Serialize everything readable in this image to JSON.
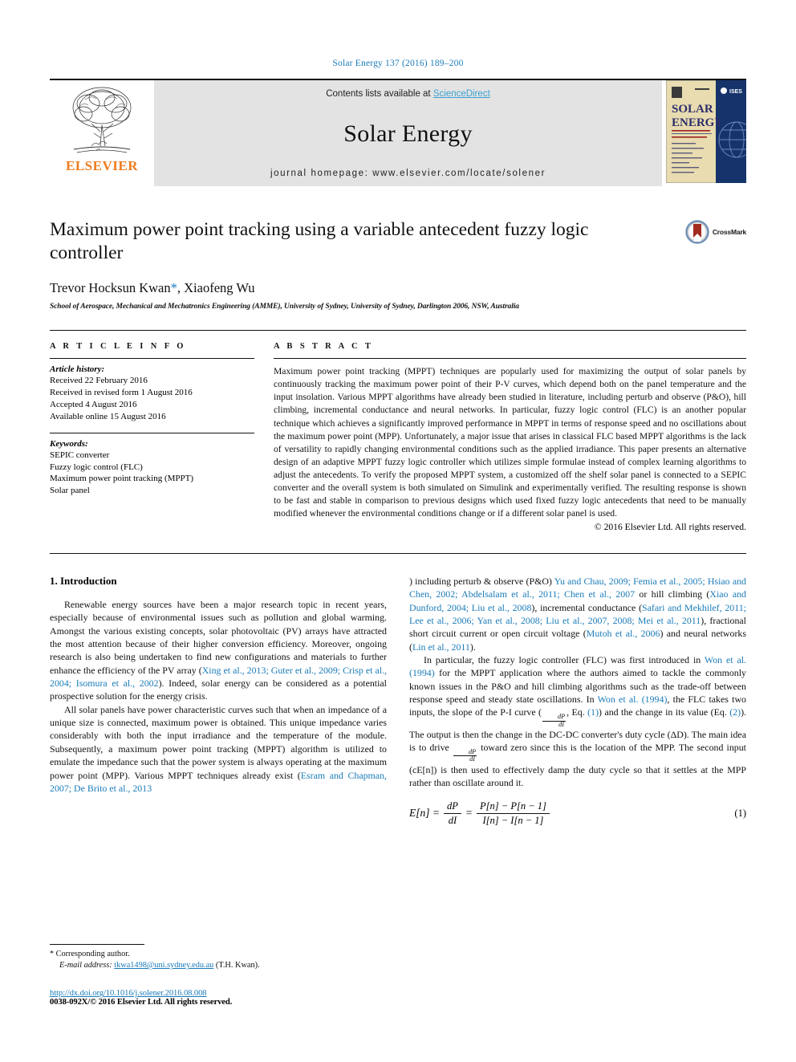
{
  "running_head": "Solar Energy 137 (2016) 189–200",
  "masthead": {
    "publisher_name": "ELSEVIER",
    "contents_prefix": "Contents lists available at ",
    "sciencedirect": "ScienceDirect",
    "journal_title": "Solar Energy",
    "homepage": "journal homepage: www.elsevier.com/locate/solener",
    "cover": {
      "title_line1": "SOLAR",
      "title_line2": "ENERGY",
      "society_badge": "ISES"
    },
    "link_color": "#3aa0d1"
  },
  "article": {
    "title": "Maximum power point tracking using a variable antecedent fuzzy logic controller",
    "crossmark_label": "CrossMark",
    "authors": "Trevor Hocksun Kwan",
    "author_star": "*",
    "authors_rest": ", Xiaofeng Wu",
    "affiliation": "School of Aerospace, Mechanical and Mechatronics Engineering (AMME), University of Sydney, University of Sydney, Darlington 2006, NSW, Australia"
  },
  "article_info": {
    "heading": "A R T I C L E   I N F O",
    "history_label": "Article history:",
    "history": [
      "Received 22 February 2016",
      "Received in revised form 1 August 2016",
      "Accepted 4 August 2016",
      "Available online 15 August 2016"
    ],
    "keywords_label": "Keywords:",
    "keywords": [
      "SEPIC converter",
      "Fuzzy logic control (FLC)",
      "Maximum power point tracking (MPPT)",
      "Solar panel"
    ]
  },
  "abstract": {
    "heading": "A B S T R A C T",
    "text": "Maximum power point tracking (MPPT) techniques are popularly used for maximizing the output of solar panels by continuously tracking the maximum power point of their P-V curves, which depend both on the panel temperature and the input insolation. Various MPPT algorithms have already been studied in literature, including perturb and observe (P&O), hill climbing, incremental conductance and neural networks. In particular, fuzzy logic control (FLC) is an another popular technique which achieves a significantly improved performance in MPPT in terms of response speed and no oscillations about the maximum power point (MPP). Unfortunately, a major issue that arises in classical FLC based MPPT algorithms is the lack of versatility to rapidly changing environmental conditions such as the applied irradiance. This paper presents an alternative design of an adaptive MPPT fuzzy logic controller which utilizes simple formulae instead of complex learning algorithms to adjust the antecedents. To verify the proposed MPPT system, a customized off the shelf solar panel is connected to a SEPIC converter and the overall system is both simulated on Simulink and experimentally verified. The resulting response is shown to be fast and stable in comparison to previous designs which used fixed fuzzy logic antecedents that need to be manually modified whenever the environmental conditions change or if a different solar panel is used.",
    "copyright": "© 2016 Elsevier Ltd. All rights reserved."
  },
  "introduction": {
    "heading": "1. Introduction",
    "left_para1_a": "Renewable energy sources have been a major research topic in recent years, especially because of environmental issues such as pollution and global warming. Amongst the various existing concepts, solar photovoltaic (PV) arrays have attracted the most attention because of their higher conversion efficiency. Moreover, ongoing research is also being undertaken to find new configurations and materials to further enhance the efficiency of the PV array (",
    "left_para1_cite": "Xing et al., 2013; Guter et al., 2009; Crisp et al., 2004; Isomura et al., 2002",
    "left_para1_b": "). Indeed, solar energy can be considered as a potential prospective solution for the energy crisis.",
    "left_para2_a": "All solar panels have power characteristic curves such that when an impedance of a unique size is connected, maximum power is obtained. This unique impedance varies considerably with both the input irradiance and the temperature of the module. Subsequently, a maximum power point tracking (MPPT) algorithm is utilized to emulate the impedance such that the power system is always operating at the maximum power point (MPP). Various MPPT techniques already exist (",
    "left_para2_cite": "Esram and Chapman, 2007; De Brito et al., 2013",
    "right_para1_a": ") including perturb & observe (P&O) ",
    "right_para1_cite1": "Yu and Chau, 2009; Femia et al., 2005; Hsiao and Chen, 2002; Abdelsalam et al., 2011; Chen et al., 2007",
    "right_para1_b": " or hill climbing (",
    "right_para1_cite2": "Xiao and Dunford, 2004; Liu et al., 2008",
    "right_para1_c": "), incremental conductance (",
    "right_para1_cite3": "Safari and Mekhilef, 2011; Lee et al., 2006; Yan et al., 2008; Liu et al., 2007, 2008; Mei et al., 2011",
    "right_para1_d": "), fractional short circuit current or open circuit voltage (",
    "right_para1_cite4": "Mutoh et al., 2006",
    "right_para1_e": ") and neural networks (",
    "right_para1_cite5": "Lin et al., 2011",
    "right_para1_f": ").",
    "right_para2_a": "In particular, the fuzzy logic controller (FLC) was first introduced in ",
    "right_para2_cite1": "Won et al. (1994)",
    "right_para2_b": " for the MPPT application where the authors aimed to tackle the commonly known issues in the P&O and hill climbing algorithms such as the trade-off between response speed and steady state oscillations. In ",
    "right_para2_cite2": "Won et al. (1994)",
    "right_para2_c": ", the FLC takes two inputs, the slope of the P-I curve (",
    "frac_num": "dP",
    "frac_den": "dI",
    "right_para2_d": ", Eq. ",
    "right_para2_cite3": "(1)",
    "right_para2_e": ") and the change in its value (Eq. ",
    "right_para2_cite4": "(2)",
    "right_para2_f": "). The output is then the change in the DC-DC converter's duty cycle (ΔD). The main idea is to drive ",
    "right_para2_g": " toward zero since this is the location of the MPP. The second input (cE[n]) is then used to effectively damp the duty cycle so that it settles at the MPP rather than oscillate around it."
  },
  "equation_1": {
    "lhs": "E[n] =",
    "frac1_num": "dP",
    "frac1_den": "dI",
    "equals": "=",
    "frac2_num": "P[n] − P[n − 1]",
    "frac2_den": "I[n] − I[n − 1]",
    "number": "(1)"
  },
  "footnotes": {
    "star": "*",
    "corresponding": "Corresponding author.",
    "email_label": "E-mail address:",
    "email": "tkwa1498@uni.sydney.edu.au",
    "email_suffix": "(T.H. Kwan).",
    "doi": "http://dx.doi.org/10.1016/j.solener.2016.08.008",
    "issn": "0038-092X/© 2016 Elsevier Ltd. All rights reserved."
  }
}
